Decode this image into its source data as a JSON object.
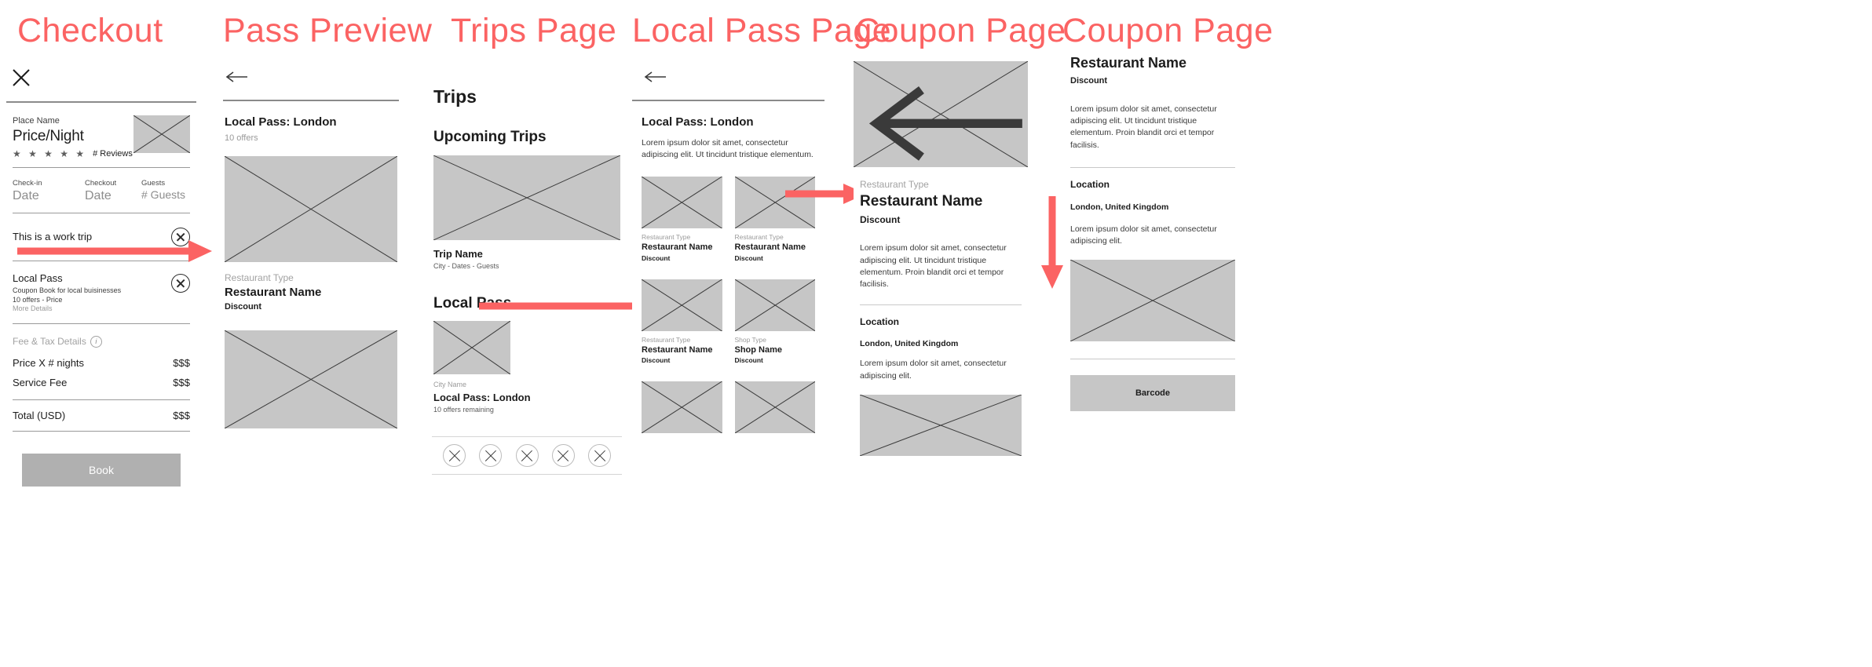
{
  "panels": [
    {
      "title": "Checkout"
    },
    {
      "title": "Pass Preview"
    },
    {
      "title": "Trips Page"
    },
    {
      "title": "Local Pass Page"
    },
    {
      "title": "Coupon Page"
    },
    {
      "title": "Coupon Page"
    }
  ],
  "checkout": {
    "close_icon": "close-icon",
    "listing": {
      "place_name": "Place Name",
      "price": "Price/Night",
      "stars": "★ ★ ★ ★ ★",
      "reviews": "# Reviews"
    },
    "dates": {
      "checkin_label": "Check-in",
      "checkin_value": "Date",
      "checkout_label": "Checkout",
      "checkout_value": "Date",
      "guests_label": "Guests",
      "guests_value": "# Guests"
    },
    "work_trip": {
      "label": "This is a work trip",
      "toggle": "toggle-switch"
    },
    "local_pass": {
      "title": "Local Pass",
      "subtitle": "Coupon Book for local buisinesses",
      "offers": "10 offers - Price",
      "more_details": "More Details",
      "toggle": "toggle-switch"
    },
    "fees": {
      "heading": "Fee & Tax Details",
      "info_icon": "info-icon",
      "rows": [
        {
          "label": "Price X # nights",
          "value": "$$$"
        },
        {
          "label": "Service Fee",
          "value": "$$$"
        }
      ],
      "total_label": "Total (USD)",
      "total_value": "$$$"
    },
    "book_button": "Book"
  },
  "pass_preview": {
    "back_icon": "back-arrow-icon",
    "title": "Local Pass: London",
    "offers": "10 offers",
    "card": {
      "type": "Restaurant Type",
      "name": "Restaurant Name",
      "discount": "Discount"
    }
  },
  "trips": {
    "title": "Trips",
    "upcoming_heading": "Upcoming Trips",
    "trip": {
      "name": "Trip Name",
      "meta": "City - Dates - Guests"
    },
    "local_pass_heading": "Local Pass",
    "pass_card": {
      "city": "City Name",
      "title": "Local Pass: London",
      "offers": "10 offers remaining"
    },
    "nav_icons": [
      "nav-icon-explore",
      "nav-icon-saved",
      "nav-icon-trips",
      "nav-icon-inbox",
      "nav-icon-profile"
    ]
  },
  "local_pass_page": {
    "back_icon": "back-arrow-icon",
    "title": "Local Pass: London",
    "description": "Lorem ipsum dolor sit amet, consectetur adipiscing elit. Ut tincidunt tristique elementum.",
    "cards": [
      {
        "type": "Restaurant Type",
        "name": "Restaurant Name",
        "discount": "Discount"
      },
      {
        "type": "Restaurant Type",
        "name": "Restaurant Name",
        "discount": "Discount"
      },
      {
        "type": "Restaurant Type",
        "name": "Restaurant Name",
        "discount": "Discount"
      },
      {
        "type": "Shop Type",
        "name": "Shop Name",
        "discount": "Discount"
      }
    ]
  },
  "coupon_page": {
    "back_icon": "back-arrow-icon",
    "type": "Restaurant Type",
    "name": "Restaurant Name",
    "discount": "Discount",
    "description": "Lorem ipsum dolor sit amet, consectetur adipiscing elit. Ut tincidunt tristique elementum. Proin blandit orci et tempor facilisis.",
    "location_heading": "Location",
    "location_value": "London, United Kingdom",
    "location_description": "Lorem ipsum dolor sit amet, consectetur adipiscing elit."
  },
  "coupon_page_scrolled": {
    "name": "Restaurant Name",
    "discount": "Discount",
    "description": "Lorem ipsum dolor sit amet, consectetur adipiscing elit. Ut tincidunt tristique elementum. Proin blandit orci et tempor facilisis.",
    "location_heading": "Location",
    "location_value": "London, United Kingdom",
    "location_description": "Lorem ipsum dolor sit amet, consectetur adipiscing elit.",
    "barcode_label": "Barcode"
  },
  "colors": {
    "accent": "#fb6363",
    "placeholder": "#c6c6c6",
    "button": "#b0b0b0"
  }
}
